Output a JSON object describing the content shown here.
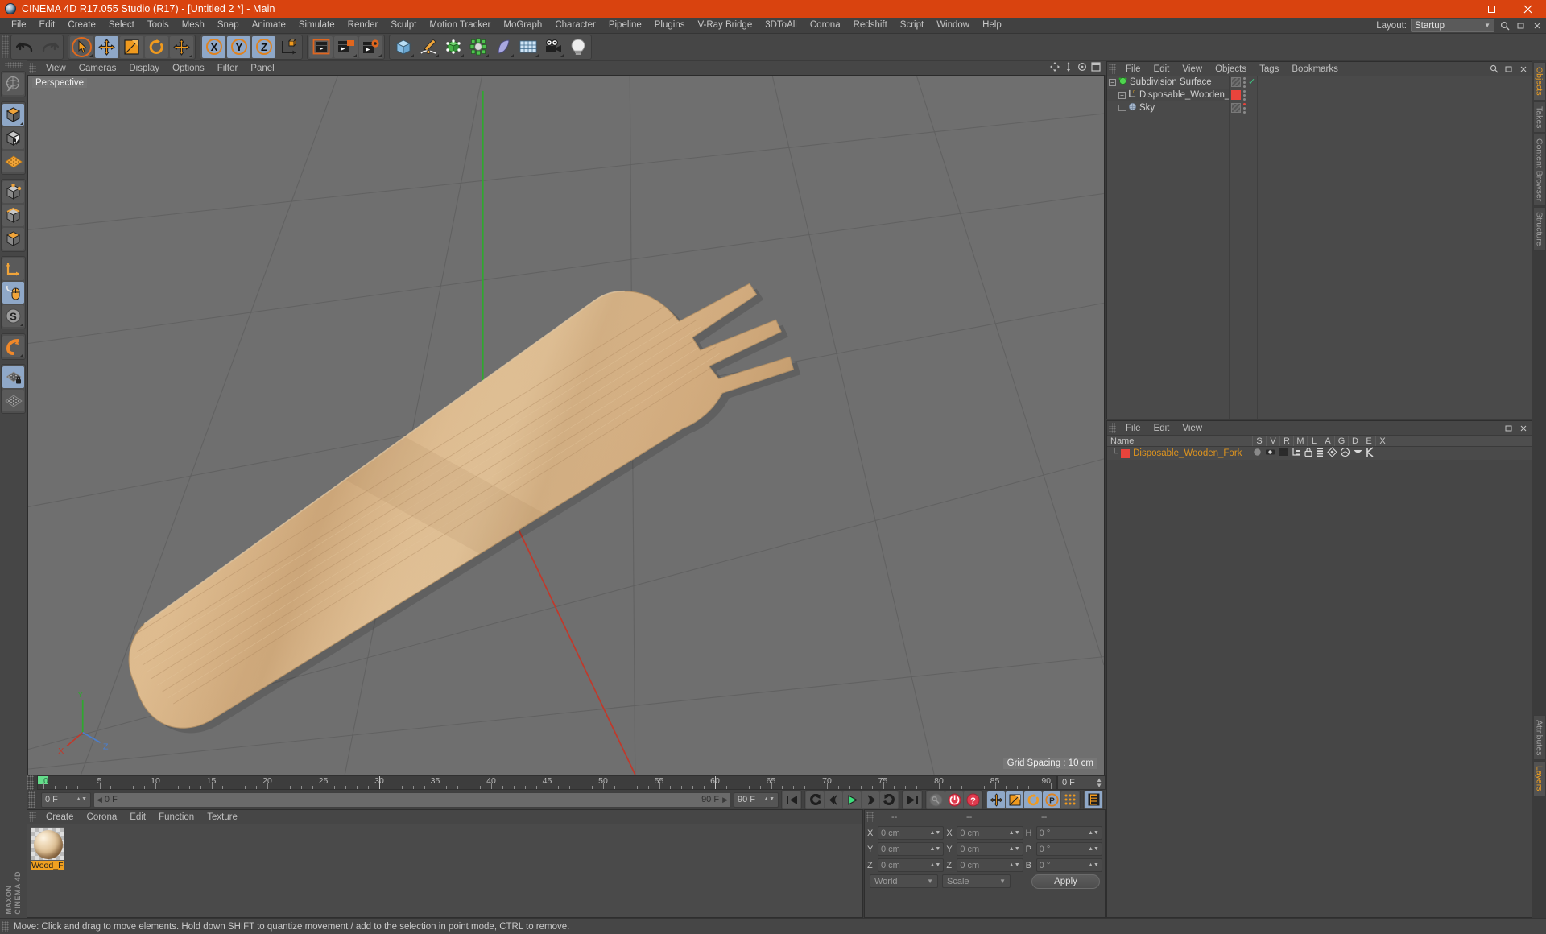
{
  "window": {
    "title": "CINEMA 4D R17.055 Studio (R17) - [Untitled 2 *] - Main",
    "logo_icon": "c4d-logo-icon",
    "minimize_icon": "minimize-icon",
    "maximize_icon": "maximize-icon",
    "close_icon": "close-icon",
    "accent_color": "#d9430f"
  },
  "menubar": {
    "items": [
      "File",
      "Edit",
      "Create",
      "Select",
      "Tools",
      "Mesh",
      "Snap",
      "Animate",
      "Simulate",
      "Render",
      "Sculpt",
      "Motion Tracker",
      "MoGraph",
      "Character",
      "Pipeline",
      "Plugins",
      "V-Ray Bridge",
      "3DToAll",
      "Corona",
      "Redshift",
      "Script",
      "Window",
      "Help"
    ],
    "layout_label": "Layout:",
    "layout_value": "Startup",
    "search_icon": "search-icon",
    "restore_icon": "restore-window-icon",
    "close_panel_icon": "close-panel-icon"
  },
  "toolbar": {
    "groups": [
      {
        "buttons": [
          {
            "name": "undo-button",
            "icon": "undo-arrow-icon",
            "state": "normal"
          },
          {
            "name": "redo-button",
            "icon": "redo-arrow-icon",
            "state": "disabled"
          }
        ]
      },
      {
        "buttons": [
          {
            "name": "live-selection-tool",
            "icon": "cursor-circle-icon",
            "state": "normal"
          },
          {
            "name": "move-tool",
            "icon": "move-cross-icon",
            "state": "active"
          },
          {
            "name": "scale-tool",
            "icon": "scale-box-icon",
            "state": "normal"
          },
          {
            "name": "rotate-tool",
            "icon": "rotate-arc-icon",
            "state": "normal"
          },
          {
            "name": "extra-move-tool",
            "icon": "move-cross-icon",
            "state": "normal"
          }
        ]
      },
      {
        "buttons": [
          {
            "name": "lock-x-axis-button",
            "icon": "axis-x-icon",
            "state": "active",
            "label": "X"
          },
          {
            "name": "lock-y-axis-button",
            "icon": "axis-y-icon",
            "state": "active",
            "label": "Y"
          },
          {
            "name": "lock-z-axis-button",
            "icon": "axis-z-icon",
            "state": "active",
            "label": "Z"
          },
          {
            "name": "world-object-coords-button",
            "icon": "world-axis-cube-icon",
            "state": "normal"
          }
        ]
      },
      {
        "buttons": [
          {
            "name": "render-view-button",
            "icon": "clapper-render-icon",
            "state": "normal"
          },
          {
            "name": "render-region-button",
            "icon": "clapper-region-icon",
            "state": "normal"
          },
          {
            "name": "render-settings-button",
            "icon": "clapper-gear-icon",
            "state": "normal"
          }
        ]
      },
      {
        "buttons": [
          {
            "name": "add-cube-button",
            "icon": "cube-icon",
            "state": "normal"
          },
          {
            "name": "add-spline-button",
            "icon": "pen-spline-icon",
            "state": "normal"
          },
          {
            "name": "add-nurbs-button",
            "icon": "green-cube-nurbs-icon",
            "state": "normal"
          },
          {
            "name": "add-array-button",
            "icon": "green-array-icon",
            "state": "normal"
          },
          {
            "name": "add-bend-deformer-button",
            "icon": "bend-deformer-icon",
            "state": "normal"
          },
          {
            "name": "add-floor-button",
            "icon": "floor-grid-icon",
            "state": "normal"
          },
          {
            "name": "add-camera-button",
            "icon": "camera-icon",
            "state": "normal"
          },
          {
            "name": "add-light-button",
            "icon": "light-bulb-icon",
            "state": "normal"
          }
        ]
      }
    ]
  },
  "leftbar": {
    "groups": [
      {
        "buttons": [
          {
            "name": "workplane-tool",
            "icon": "globe-sphere-icon",
            "state": "normal"
          }
        ]
      },
      {
        "buttons": [
          {
            "name": "editable-object-mode",
            "icon": "orange-cube-icon",
            "state": "active"
          },
          {
            "name": "texture-mode",
            "icon": "checker-cube-icon",
            "state": "normal"
          },
          {
            "name": "uv-mesh-mode",
            "icon": "orange-grid-icon",
            "state": "normal"
          }
        ]
      },
      {
        "buttons": [
          {
            "name": "points-mode",
            "icon": "cube-points-icon",
            "state": "normal"
          },
          {
            "name": "edges-mode",
            "icon": "cube-edges-icon",
            "state": "normal"
          },
          {
            "name": "polygons-mode",
            "icon": "cube-polygons-icon",
            "state": "normal"
          }
        ]
      },
      {
        "buttons": [
          {
            "name": "object-axis-mode",
            "icon": "axis-arrow-icon",
            "state": "normal"
          },
          {
            "name": "viewport-solo-mode",
            "icon": "mouse-icon",
            "state": "active"
          },
          {
            "name": "snap-settings-button",
            "icon": "s-circle-icon",
            "state": "normal"
          }
        ]
      },
      {
        "buttons": [
          {
            "name": "magnet-tool",
            "icon": "magnet-icon",
            "state": "normal"
          }
        ]
      },
      {
        "buttons": [
          {
            "name": "lock-workplane-button",
            "icon": "grid-lock-icon",
            "state": "active"
          },
          {
            "name": "workplane-grid-button",
            "icon": "grid-icon",
            "state": "normal"
          }
        ]
      }
    ],
    "brand_line1": "MAXON",
    "brand_line2": "CINEMA 4D"
  },
  "viewport": {
    "menu_items": [
      "View",
      "Cameras",
      "Display",
      "Options",
      "Filter",
      "Panel"
    ],
    "label": "Perspective",
    "grid_spacing": "Grid Spacing : 10 cm",
    "nav_icons": [
      "pan-view-icon",
      "zoom-view-icon",
      "rotate-view-icon",
      "maximize-view-icon"
    ],
    "axis_gizmo": {
      "x_label": "X",
      "y_label": "Y",
      "z_label": "Z"
    },
    "background_color": "#6f6f6f",
    "object_color": "#dcb98a",
    "object_name": "Disposable Wooden Fork"
  },
  "timeline": {
    "ticks": [
      0,
      5,
      10,
      15,
      20,
      25,
      30,
      35,
      40,
      45,
      50,
      55,
      60,
      65,
      70,
      75,
      80,
      85,
      90
    ],
    "range_start": 0,
    "range_end": 90,
    "current_frame_label": "0 F",
    "end_frame_label": "90 F",
    "preview_min_label": "0 F",
    "preview_max_label": "90 F",
    "doc_end_label": "90 F",
    "transport": [
      {
        "name": "go-to-start-button",
        "icon": "skip-start-icon",
        "state": "normal"
      },
      {
        "name": "previous-keyframe-button",
        "icon": "prev-key-icon",
        "state": "normal"
      },
      {
        "name": "step-back-button",
        "icon": "step-back-icon",
        "state": "normal"
      },
      {
        "name": "play-button",
        "icon": "play-icon",
        "state": "normal"
      },
      {
        "name": "step-forward-button",
        "icon": "step-forward-icon",
        "state": "normal"
      },
      {
        "name": "next-keyframe-button",
        "icon": "next-key-icon",
        "state": "normal"
      },
      {
        "name": "go-to-end-button",
        "icon": "skip-end-icon",
        "state": "normal"
      },
      {
        "name": "record-active-objects-button",
        "icon": "key-icon",
        "state": "disabled"
      },
      {
        "name": "autokeying-button",
        "icon": "autokey-circle-icon",
        "state": "normal"
      },
      {
        "name": "keyframe-selection-button",
        "icon": "question-circle-icon",
        "state": "normal"
      },
      {
        "name": "position-key-button",
        "icon": "move-cross-icon",
        "state": "active"
      },
      {
        "name": "scale-key-button",
        "icon": "scale-box-icon",
        "state": "active"
      },
      {
        "name": "rotation-key-button",
        "icon": "rotate-arc-icon",
        "state": "active"
      },
      {
        "name": "parameter-key-button",
        "icon": "p-circle-icon",
        "state": "active"
      },
      {
        "name": "point-level-animation-button",
        "icon": "pla-dots-icon",
        "state": "normal"
      },
      {
        "name": "timeline-toggle-button",
        "icon": "film-strip-icon",
        "state": "active"
      }
    ]
  },
  "material_manager": {
    "menu_items": [
      "Create",
      "Corona",
      "Edit",
      "Function",
      "Texture"
    ],
    "materials": [
      {
        "name": "Wood_F",
        "icon": "material-sphere-icon",
        "selected": true
      }
    ]
  },
  "coordinates": {
    "headers": [
      "--",
      "--",
      "--"
    ],
    "rows": [
      {
        "pos_label": "X",
        "pos_value": "0 cm",
        "size_label": "X",
        "size_value": "0 cm",
        "rot_label": "H",
        "rot_value": "0 °"
      },
      {
        "pos_label": "Y",
        "pos_value": "0 cm",
        "size_label": "Y",
        "size_value": "0 cm",
        "rot_label": "P",
        "rot_value": "0 °"
      },
      {
        "pos_label": "Z",
        "pos_value": "0 cm",
        "size_label": "Z",
        "size_value": "0 cm",
        "rot_label": "B",
        "rot_value": "0 °"
      }
    ],
    "coord_system": "World",
    "mode": "Scale",
    "apply_label": "Apply"
  },
  "object_manager": {
    "menu_items": [
      "File",
      "Edit",
      "View",
      "Objects",
      "Tags",
      "Bookmarks"
    ],
    "objects": [
      {
        "name": "Subdivision Surface",
        "icon": "subdivision-surface-icon",
        "indent": 0,
        "expandable": true,
        "expand_glyph": "−",
        "tag_type": "hatch",
        "check": true
      },
      {
        "name": "Disposable_Wooden_Fork",
        "icon": "polygon-object-icon",
        "indent": 1,
        "expandable": true,
        "expand_glyph": "+",
        "tag_type": "red",
        "check": false
      },
      {
        "name": "Sky",
        "icon": "sky-sphere-icon",
        "indent": 1,
        "expandable": false,
        "expand_glyph": "",
        "tag_type": "hatch",
        "check": false,
        "red_dot": true
      }
    ],
    "search_icon": "search-icon"
  },
  "layers_manager": {
    "menu_items": [
      "File",
      "Edit",
      "View"
    ],
    "columns": [
      "Name",
      "S",
      "V",
      "R",
      "M",
      "L",
      "A",
      "G",
      "D",
      "E",
      "X"
    ],
    "rows": [
      {
        "name": "Disposable_Wooden_Fork",
        "color": "#e8443c",
        "icons": [
          "solo-dot-icon",
          "visible-eye-icon",
          "render-clapper-icon",
          "manager-icon",
          "lock-icon",
          "animation-icon",
          "generator-icon",
          "deformer-icon",
          "expression-icon",
          "xref-icon"
        ]
      }
    ]
  },
  "right_tabs": {
    "top": [
      {
        "label": "Objects",
        "active": true
      },
      {
        "label": "Takes",
        "active": false
      },
      {
        "label": "Content Browser",
        "active": false
      },
      {
        "label": "Structure",
        "active": false
      }
    ],
    "bottom": [
      {
        "label": "Attributes",
        "active": false
      },
      {
        "label": "Layers",
        "active": true
      }
    ]
  },
  "statusbar": {
    "message": "Move: Click and drag to move elements. Hold down SHIFT to quantize movement / add to the selection in point mode, CTRL to remove."
  }
}
